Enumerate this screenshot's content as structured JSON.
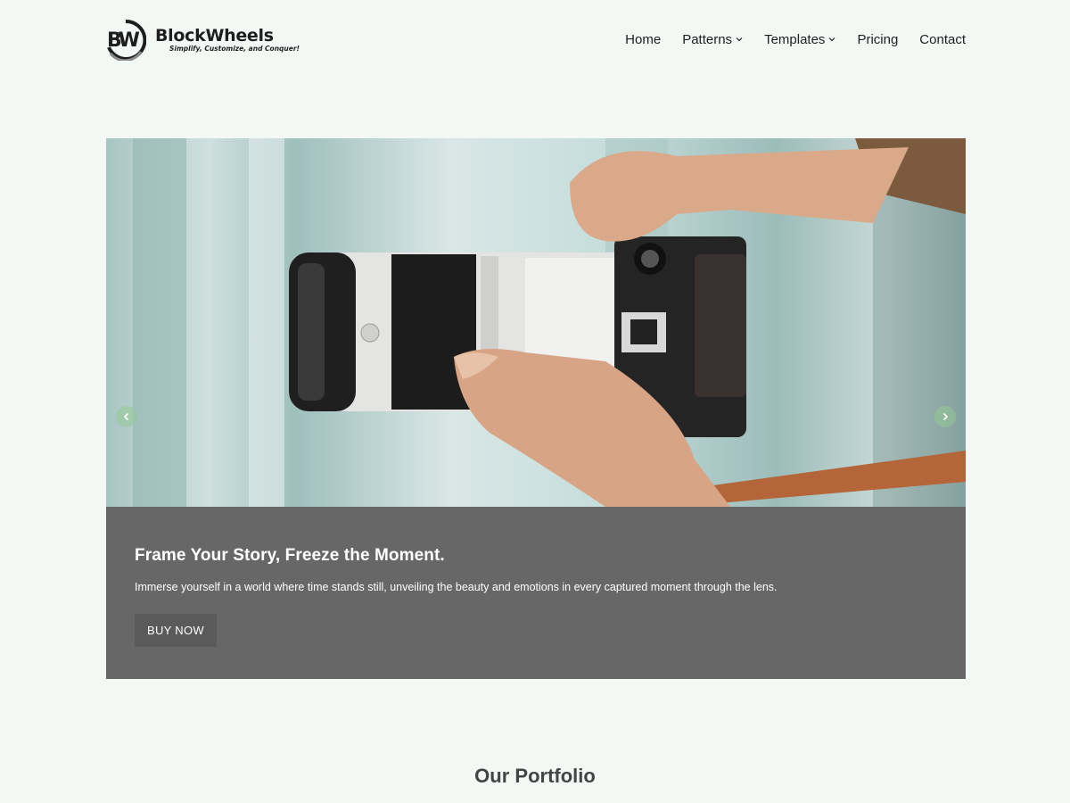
{
  "brand": {
    "name": "BlockWheels",
    "tagline": "Simplify, Customize, and Conquer!",
    "mark_initials": "BW"
  },
  "nav": {
    "items": [
      {
        "label": "Home"
      },
      {
        "label": "Patterns"
      },
      {
        "label": "Templates"
      },
      {
        "label": "Pricing"
      },
      {
        "label": "Contact"
      }
    ]
  },
  "hero": {
    "image_subject": "camera-lens-photo",
    "title": "Frame Your Story, Freeze the Moment.",
    "text": "Immerse yourself in a world where time stands still, unveiling the beauty and emotions in every captured moment through the lens.",
    "button_label": "BUY NOW"
  },
  "portfolio": {
    "title": "Our Portfolio"
  },
  "colors": {
    "background": "#f3f8f5",
    "caption_bg": "#676767",
    "button_bg": "#5a5a5a",
    "arrow_bg": "#96c896"
  }
}
